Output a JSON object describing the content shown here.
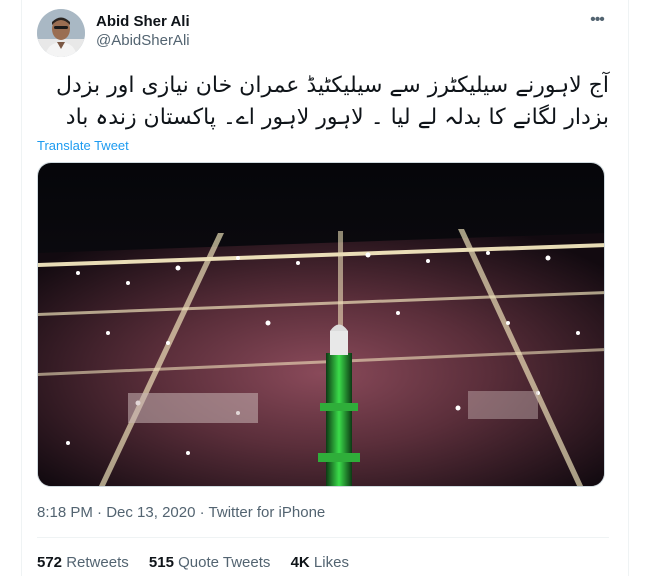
{
  "author": {
    "display_name": "Abid Sher Ali",
    "handle": "@AbidSherAli"
  },
  "more_icon": "more-horizontal-icon",
  "tweet": {
    "text_line1": "آج لاہورنے سیلیکٹرز سے سیلیکٹیڈ عمران خان نیازی اور بزدل",
    "text_line2": "بزدار لگانے کا بدلہ لے لیا ۔ لاہور لاہور اے۔ پاکستان زندہ باد",
    "translate_label": "Translate Tweet"
  },
  "meta": {
    "time": "8:18 PM",
    "date": "Dec 13, 2020",
    "source": "Twitter for iPhone",
    "separator": "·"
  },
  "stats": {
    "retweets_count": "572",
    "retweets_label": "Retweets",
    "quotes_count": "515",
    "quotes_label": "Quote Tweets",
    "likes_count": "4K",
    "likes_label": "Likes"
  },
  "colors": {
    "link": "#1d9bf0",
    "secondary": "#536471",
    "primary": "#0f1419"
  }
}
